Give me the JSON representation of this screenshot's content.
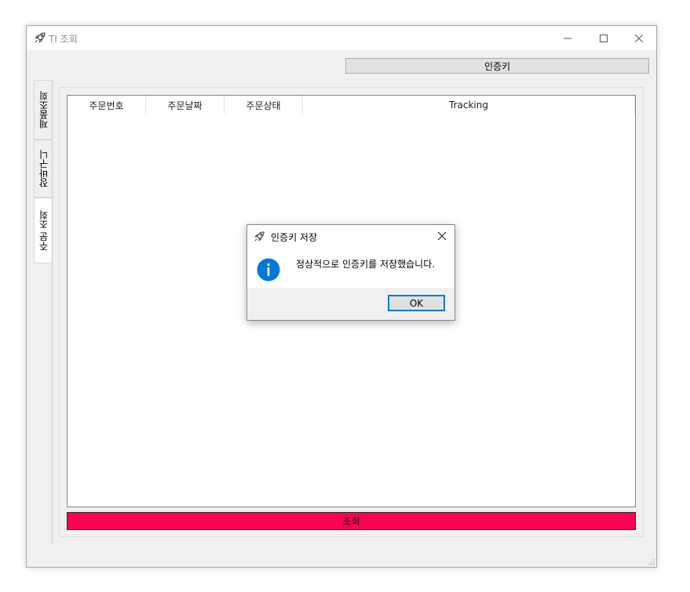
{
  "window": {
    "title": "TI 조회",
    "icon": "rocket-icon"
  },
  "toolbar": {
    "auth_key_label": "인증키"
  },
  "tabs": [
    {
      "label": "제품조회",
      "active": false
    },
    {
      "label": "장바구니",
      "active": false
    },
    {
      "label": "주문 조회",
      "active": true
    }
  ],
  "orders_table": {
    "columns": [
      "주문번호",
      "주문날짜",
      "주문상태",
      "Tracking"
    ],
    "rows": []
  },
  "query_button": {
    "label": "조회",
    "color": "#ff0052"
  },
  "dialog": {
    "title": "인증키 저장",
    "message": "정상적으로 인증키를 저장했습니다.",
    "ok_label": "OK",
    "icon": "info-icon",
    "accent": "#0078d7"
  }
}
